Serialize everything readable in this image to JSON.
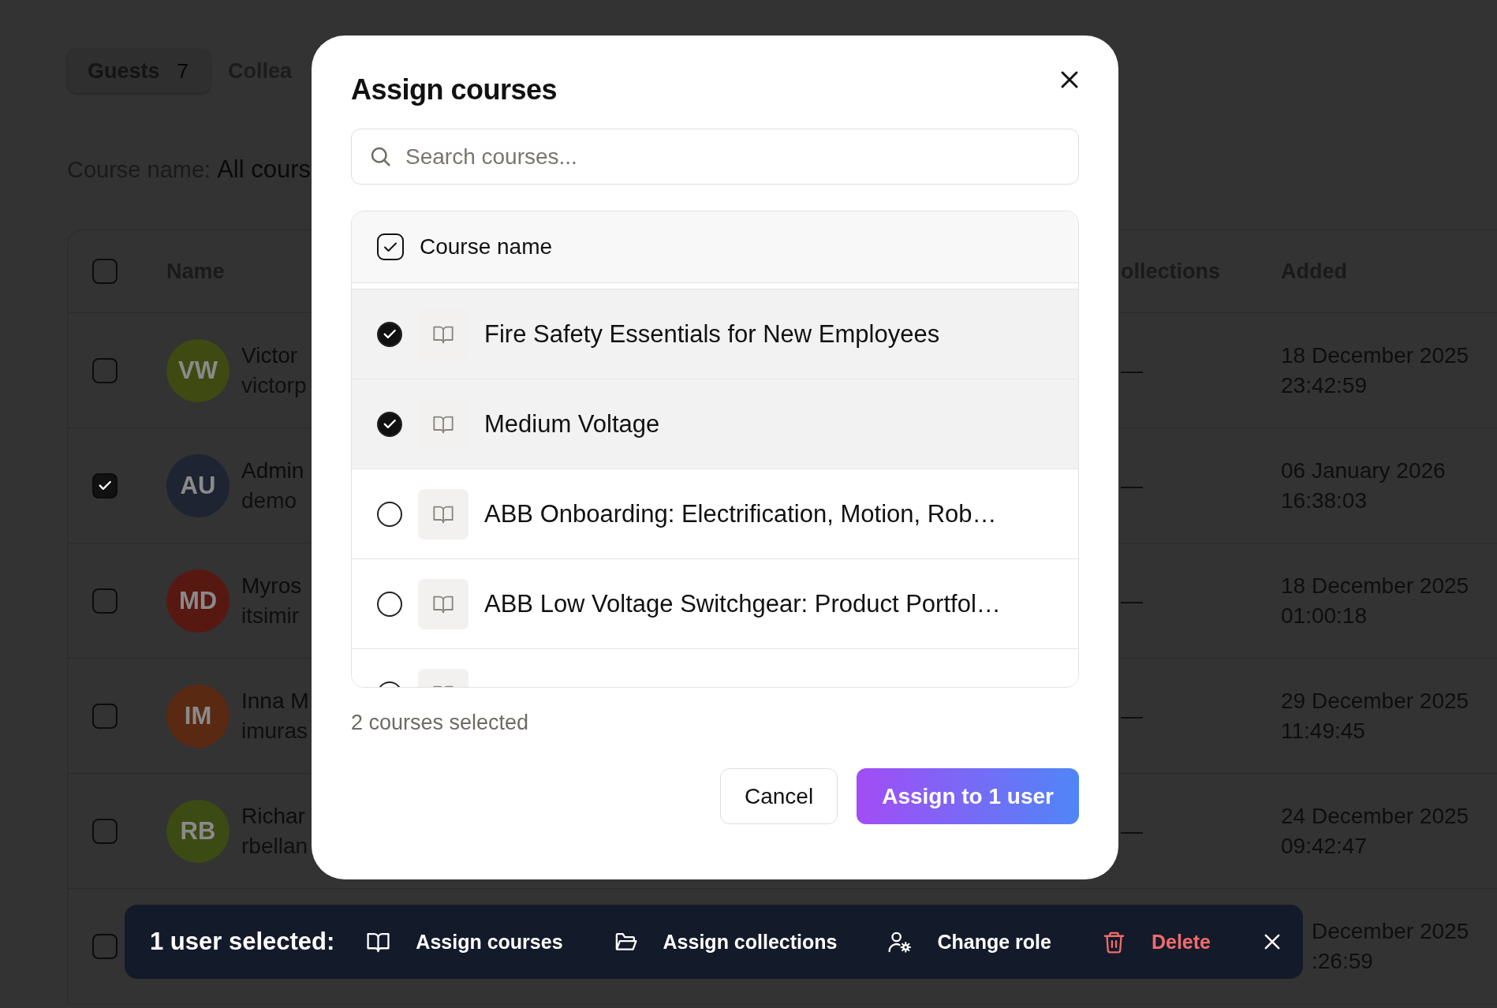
{
  "tabs": [
    {
      "label": "Guests",
      "count": "7",
      "selected": true
    },
    {
      "label": "Collea",
      "selected": false
    }
  ],
  "filter": {
    "label": "Course name:",
    "value": "All cours"
  },
  "table": {
    "select_all": false,
    "columns": [
      "Name",
      "ollections",
      "Added"
    ],
    "rows": [
      {
        "selected": false,
        "initials": "VW",
        "color": "#3e4a12",
        "name": "Victor",
        "email": "victorp",
        "collections": "—",
        "added": [
          "18 December 2025",
          "23:42:59"
        ]
      },
      {
        "selected": true,
        "initials": "AU",
        "color": "#1f2433",
        "name": "Admin",
        "email": "demo",
        "collections": "—",
        "added": [
          "06 January 2026",
          "16:38:03"
        ]
      },
      {
        "selected": false,
        "initials": "MD",
        "color": "#581812",
        "name": "Myros",
        "email": "itsimir",
        "collections": "—",
        "added": [
          "18 December 2025",
          "01:00:18"
        ]
      },
      {
        "selected": false,
        "initials": "IM",
        "color": "#5a2912",
        "name": "Inna M",
        "email": "imuras",
        "collections": "—",
        "added": [
          "29 December 2025",
          "11:49:45"
        ]
      },
      {
        "selected": false,
        "initials": "RB",
        "color": "#3c4a14",
        "name": "Richar",
        "email": "rbellan",
        "collections": "—",
        "added": [
          "24 December 2025",
          "09:42:47"
        ]
      },
      {
        "selected": false,
        "added": [
          "December 2025",
          ":26:59"
        ]
      }
    ]
  },
  "dialog": {
    "title": "Assign courses",
    "search": {
      "placeholder": "Search courses..."
    },
    "header": {
      "label": "Course name",
      "partial": true
    },
    "courses": [
      {
        "name": "Fire Safety Essentials for New Employees",
        "selected": true
      },
      {
        "name": "Medium Voltage",
        "selected": true
      },
      {
        "name": "ABB Onboarding: Electrification, Motion, Rob…",
        "selected": false
      },
      {
        "name": "ABB Low Voltage Switchgear: Product Portfol…",
        "selected": false
      },
      {
        "selected": false
      }
    ],
    "summary": "2 courses selected",
    "buttons": [
      {
        "label": "Cancel",
        "primary": false
      },
      {
        "label": "Assign to 1 user",
        "primary": true
      }
    ]
  },
  "action_bar": {
    "title": "1 user selected:",
    "actions": [
      {
        "label": "Assign courses",
        "kind": "book",
        "danger": false
      },
      {
        "label": "Assign collections",
        "kind": "folder",
        "danger": false
      },
      {
        "label": "Change role",
        "kind": "user-gear",
        "danger": false
      },
      {
        "label": "Delete",
        "kind": "trash",
        "danger": true
      }
    ]
  }
}
